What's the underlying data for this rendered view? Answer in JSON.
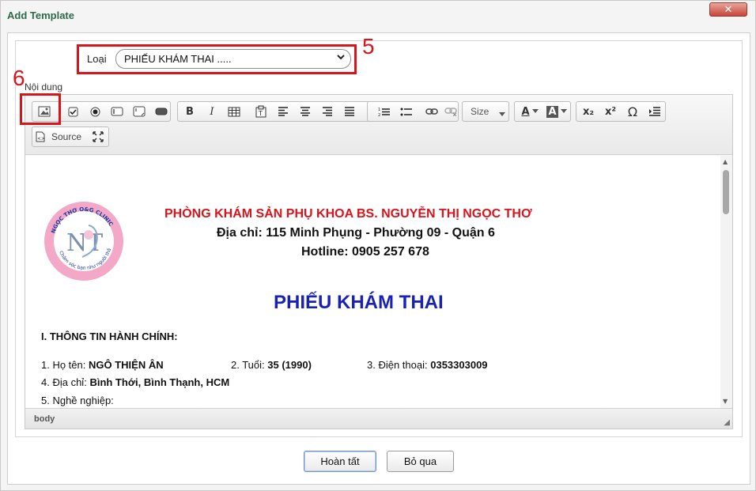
{
  "dialog": {
    "title": "Add Template",
    "close_icon": "close-x-icon"
  },
  "form": {
    "loai_label": "Loại",
    "loai_value": "PHIẾU KHÁM THAI .....",
    "noidung_label": "Nội dung"
  },
  "annotations": {
    "select_number": "5",
    "image_button_number": "6",
    "color": "#d8141c"
  },
  "toolbar": {
    "size_label": "Size",
    "source_label": "Source",
    "font_color_label": "A",
    "bg_color_label": "A",
    "subscript_label": "x₂",
    "superscript_label": "x²",
    "special_char_label": "Ω"
  },
  "document": {
    "logo_text": "NGỌC THƠ O&G CLINIC",
    "logo_tagline": "Chăm sóc bạn như người thân",
    "logo_letters": "NT",
    "clinic_name": "PHÒNG KHÁM SẢN PHỤ KHOA BS. NGUYỄN THỊ NGỌC THƠ",
    "address": "Địa chỉ: 115 Minh Phụng - Phường 09 - Quận 6",
    "hotline": "Hotline: 0905 257 678",
    "form_title": "PHIẾU KHÁM THAI",
    "section_1": "I. THÔNG TIN HÀNH CHÍNH:",
    "name_label": "1. Họ tên:",
    "name_value": "NGÔ THIỆN ÂN",
    "age_label": "2. Tuổi:",
    "age_value": "35 (1990)",
    "phone_label": "3. Điện thoại:",
    "phone_value": "0353303009",
    "address_label": "4. Địa chỉ:",
    "address_value": "Bình Thới, Bình Thạnh, HCM",
    "job_label": "5. Nghề nghiệp:"
  },
  "statusbar": {
    "path": "body"
  },
  "buttons": {
    "finish": "Hoàn tất",
    "skip": "Bỏ qua"
  },
  "colors": {
    "title": "#2d6a4a",
    "clinic_red": "#d8141c",
    "title_blue": "#1a22b5",
    "close_red": "#c8443a"
  }
}
